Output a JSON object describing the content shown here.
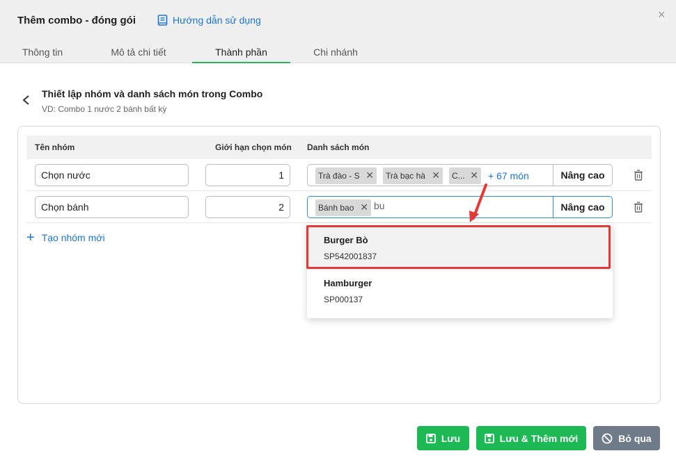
{
  "header": {
    "title": "Thêm combo - đóng gói",
    "guide_label": "Hướng dẫn sử dụng",
    "close_symbol": "×"
  },
  "tabs": [
    {
      "label": "Thông tin",
      "active": false
    },
    {
      "label": "Mô tả chi tiết",
      "active": false
    },
    {
      "label": "Thành phần",
      "active": true
    },
    {
      "label": "Chi nhánh",
      "active": false
    }
  ],
  "section": {
    "title": "Thiết lập nhóm và danh sách món trong Combo",
    "subtitle": "VD: Combo 1 nước 2 bánh bất kỳ"
  },
  "table": {
    "headers": {
      "group_name": "Tên nhóm",
      "limit": "Giới hạn chọn món",
      "items": "Danh sách món"
    },
    "rows": [
      {
        "group_name": "Chọn nước",
        "limit": "1",
        "tags": [
          "Trà đào - S",
          "Trà bạc hà",
          "C..."
        ],
        "more": "+ 67 món",
        "typed": "",
        "advanced_label": "Nâng cao"
      },
      {
        "group_name": "Chọn bánh",
        "limit": "2",
        "tags": [
          "Bánh bao"
        ],
        "more": "",
        "typed": "bu",
        "advanced_label": "Nâng cao"
      }
    ],
    "add_group_label": "Tạo nhóm mới"
  },
  "dropdown": {
    "options": [
      {
        "name": "Burger Bò",
        "code": "SP542001837",
        "selected": true
      },
      {
        "name": "Hamburger",
        "code": "SP000137",
        "selected": false
      }
    ]
  },
  "footer": {
    "save_label": "Lưu",
    "save_add_label": "Lưu & Thêm mới",
    "skip_label": "Bỏ qua"
  },
  "colors": {
    "accent_green": "#1db954",
    "link_blue": "#1a73d6",
    "highlight_red": "#e53935",
    "skip_gray": "#6f7b88"
  },
  "icons": {
    "guide": "book-icon",
    "back": "chevron-left-icon",
    "delete": "trash-icon",
    "save": "floppy-disk-icon",
    "skip": "ban-icon"
  }
}
